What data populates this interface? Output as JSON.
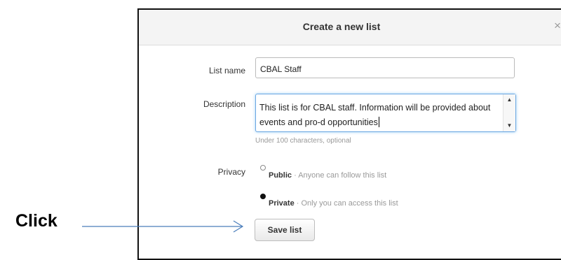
{
  "dialog": {
    "title": "Create a new list",
    "close_glyph": "×"
  },
  "form": {
    "list_name": {
      "label": "List name",
      "value": "CBAL Staff"
    },
    "description": {
      "label": "Description",
      "value": "This list is for CBAL staff. Information will be provided about events and pro-d opportunities",
      "hint": "Under 100 characters, optional"
    },
    "privacy": {
      "label": "Privacy",
      "options": [
        {
          "name": "Public",
          "detail": "· Anyone can follow this list",
          "selected": false
        },
        {
          "name": "Private",
          "detail": "· Only you can access this list",
          "selected": true
        }
      ]
    },
    "save_label": "Save list"
  },
  "annotation": {
    "text": "Click"
  },
  "icons": {
    "close": "close-icon",
    "scroll_up": "arrow-up-icon",
    "scroll_down": "arrow-down-icon",
    "pointer": "arrow-right-icon"
  }
}
